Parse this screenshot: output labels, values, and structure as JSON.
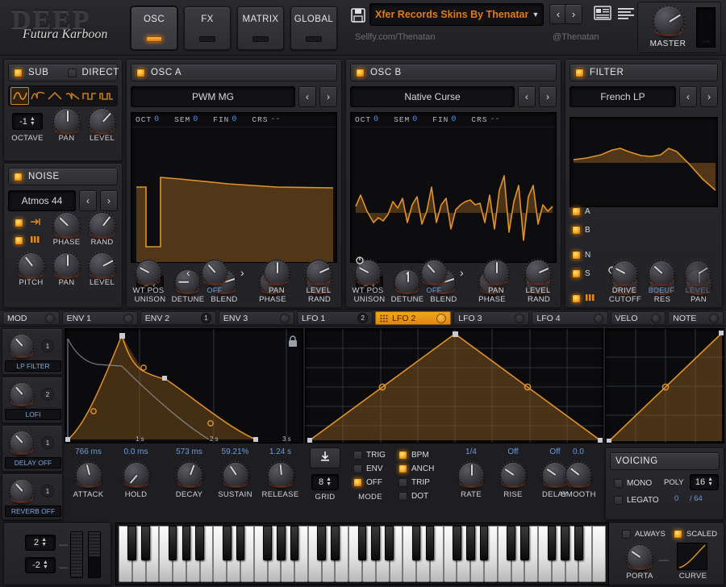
{
  "brand": {
    "name": "DEEP",
    "script": "Futura Karboon"
  },
  "top": {
    "tabs": [
      {
        "label": "OSC",
        "active": true
      },
      {
        "label": "FX",
        "active": false
      },
      {
        "label": "MATRIX",
        "active": false
      },
      {
        "label": "GLOBAL",
        "active": false
      }
    ],
    "save_icon": "floppy-disk-icon",
    "preset_name": "Xfer Records Skins By Thenatan",
    "prev_label": "‹",
    "next_label": "›",
    "menu_icon_1": "preset-browser-icon",
    "menu_icon_2": "menu-list-icon",
    "left_link": "Sellfy.com/Thenatan",
    "right_link": "@Thenatan",
    "master_label": "MASTER",
    "meter_marks": "- -"
  },
  "sub": {
    "title": "SUB",
    "direct_label": "DIRECT",
    "direct_on": false,
    "enabled": true,
    "waveforms": [
      "sine-wave-icon",
      "saw-wave-icon",
      "triangle-wave-icon",
      "ramp-wave-icon",
      "square-wave-icon",
      "pulse-wave-icon"
    ],
    "selected_waveform": 0,
    "octave_value": "-1",
    "knobs": [
      {
        "label": "OCTAVE"
      },
      {
        "label": "PAN",
        "angle": 0
      },
      {
        "label": "LEVEL",
        "angle": 42
      }
    ]
  },
  "noise": {
    "title": "NOISE",
    "enabled": true,
    "preset": "Atmos 44",
    "toggle_a": "loop-icon",
    "toggle_b": "keytrack-icon",
    "knobs": [
      {
        "label": "PHASE",
        "angle": -46
      },
      {
        "label": "RAND",
        "angle": 38
      },
      {
        "label": "PITCH",
        "angle": -38
      },
      {
        "label": "PAN",
        "angle": 0
      },
      {
        "label": "LEVEL",
        "angle": 62
      }
    ]
  },
  "oscA": {
    "title": "OSC A",
    "enabled": true,
    "wavetable": "PWM MG",
    "info": [
      {
        "label": "OCT",
        "value": "0"
      },
      {
        "label": "SEM",
        "value": "0"
      },
      {
        "label": "FIN",
        "value": "0"
      },
      {
        "label": "CRS",
        "value": "--"
      }
    ],
    "unison_value": "1",
    "unison_label": "UNISON",
    "wt_mode": "OFF",
    "knobs": [
      {
        "label": "DETUNE",
        "angle": -90
      },
      {
        "label": "BLEND",
        "angle": 72
      },
      {
        "label": "PHASE",
        "angle": 0
      },
      {
        "label": "RAND",
        "angle": 52
      },
      {
        "label": "WT POS",
        "angle": -62
      },
      {
        "label": "OFF",
        "angle": -42
      },
      {
        "label": "PAN",
        "angle": 0
      },
      {
        "label": "LEVEL",
        "angle": 66
      }
    ]
  },
  "oscB": {
    "title": "OSC B",
    "enabled": true,
    "wavetable": "Native Curse",
    "info": [
      {
        "label": "OCT",
        "value": "0"
      },
      {
        "label": "SEM",
        "value": "0"
      },
      {
        "label": "FIN",
        "value": "0"
      },
      {
        "label": "CRS",
        "value": "--"
      }
    ],
    "unison_value": "1",
    "unison_label": "UNISON",
    "wt_mode": "OFF",
    "knobs": [
      {
        "label": "DETUNE",
        "angle": 0
      },
      {
        "label": "BLEND",
        "angle": 72
      },
      {
        "label": "PHASE",
        "angle": 0
      },
      {
        "label": "RAND",
        "angle": 52
      },
      {
        "label": "WT POS",
        "angle": -62
      },
      {
        "label": "OFF",
        "angle": -42
      },
      {
        "label": "PAN",
        "angle": 0
      },
      {
        "label": "LEVEL",
        "angle": 66
      }
    ]
  },
  "filter": {
    "title": "FILTER",
    "enabled": true,
    "type": "French LP",
    "routing": [
      {
        "label": "A",
        "on": true
      },
      {
        "label": "B",
        "on": true
      },
      {
        "label": "N",
        "on": true
      },
      {
        "label": "S",
        "on": true
      },
      {
        "label": "keys-icon",
        "on": true,
        "icon": true
      }
    ],
    "knobs": [
      {
        "label": "CUTOFF",
        "angle": 42
      },
      {
        "label": "RES",
        "angle": -52
      },
      {
        "label": "PAN",
        "angle": 0
      },
      {
        "label": "DRIVE",
        "angle": -62
      },
      {
        "label": "BOEUF",
        "angle": -48
      },
      {
        "label": "LEVEL",
        "angle": 58
      }
    ],
    "boeuf_highlight": "#6c9bd8",
    "level_dim": true
  },
  "modtabs": [
    {
      "label": "MOD",
      "type": "ring",
      "active": false
    },
    {
      "label": "ENV 1",
      "type": "ring",
      "active": false
    },
    {
      "label": "ENV 2",
      "type": "num",
      "num": "1",
      "active": false
    },
    {
      "label": "ENV 3",
      "type": "ring",
      "active": false
    },
    {
      "label": "LFO 1",
      "type": "num",
      "num": "2",
      "active": false
    },
    {
      "label": "LFO 2",
      "type": "ring",
      "active": true,
      "grid": true
    },
    {
      "label": "LFO 3",
      "type": "ring",
      "active": false
    },
    {
      "label": "LFO 4",
      "type": "ring",
      "active": false
    },
    {
      "label": "VELO",
      "type": "ring",
      "active": false
    },
    {
      "label": "NOTE",
      "type": "ring",
      "active": false
    }
  ],
  "fxrack": [
    {
      "label": "LP FILTER",
      "num": "1",
      "angle": -42
    },
    {
      "label": "LOFI",
      "num": "2",
      "angle": -42
    },
    {
      "label": "DELAY OFF",
      "num": "1",
      "angle": -42
    },
    {
      "label": "REVERB OFF",
      "num": "1",
      "angle": -42
    }
  ],
  "env": {
    "time_labels": [
      "1 s",
      "2 s",
      "3 s"
    ],
    "lock_icon": "lock-icon",
    "params": [
      {
        "label": "ATTACK",
        "value": "766 ms",
        "angle": -14
      },
      {
        "label": "HOLD",
        "value": "0.0 ms",
        "angle": -140
      },
      {
        "label": "DECAY",
        "value": "573 ms",
        "angle": 20
      },
      {
        "label": "SUSTAIN",
        "value": "59.21%",
        "angle": -34
      },
      {
        "label": "RELEASE",
        "value": "1.24 s",
        "angle": -6
      }
    ]
  },
  "lfo": {
    "download_icon": "download-icon",
    "grid_value": "8",
    "grid_label": "GRID",
    "mode_label": "MODE",
    "modes": [
      {
        "label": "TRIG",
        "on": false
      },
      {
        "label": "ENV",
        "on": false
      },
      {
        "label": "OFF",
        "on": true
      }
    ],
    "syncs": [
      {
        "label": "BPM",
        "on": true
      },
      {
        "label": "ANCH",
        "on": true
      },
      {
        "label": "TRIP",
        "on": false
      },
      {
        "label": "DOT",
        "on": false
      }
    ],
    "params": [
      {
        "label": "RATE",
        "value": "1/4",
        "angle": 0
      },
      {
        "label": "RISE",
        "value": "Off",
        "angle": -56
      },
      {
        "label": "DELAY",
        "value": "Off",
        "angle": -56
      },
      {
        "label": "SMOOTH",
        "value": "0.0",
        "angle": -52
      }
    ]
  },
  "voicing": {
    "title": "VOICING",
    "mono_label": "MONO",
    "mono_on": false,
    "legato_label": "LEGATO",
    "legato_on": false,
    "poly_label": "POLY",
    "poly_value": "16",
    "voices_used": "0",
    "voices_total": "/ 64",
    "always_label": "ALWAYS",
    "always_on": false,
    "scaled_label": "SCALED",
    "scaled_on": true,
    "porta_label": "PORTA",
    "porta_angle": -56,
    "curve_label": "CURVE",
    "dash": "—"
  },
  "wheels": {
    "top_value": "2",
    "bottom_value": "-2",
    "dash": "—"
  },
  "chart_data": [
    {
      "type": "line",
      "title": "OSC A wavetable",
      "x": [
        0,
        0.06,
        0.08,
        0.085,
        0.16,
        0.165,
        0.17,
        0.22,
        0.45,
        0.7,
        1.0
      ],
      "y": [
        0.5,
        0.5,
        0.05,
        0.04,
        0.04,
        0.62,
        0.62,
        0.6,
        0.56,
        0.53,
        0.52
      ],
      "ylim": [
        0,
        1
      ],
      "xlabel": "",
      "ylabel": ""
    },
    {
      "type": "line",
      "title": "OSC B wavetable",
      "x": [
        0,
        0.03,
        0.07,
        0.11,
        0.15,
        0.2,
        0.24,
        0.28,
        0.33,
        0.37,
        0.42,
        0.47,
        0.52,
        0.57,
        0.62,
        0.67,
        0.72,
        0.77,
        0.82,
        0.87,
        0.92,
        0.97,
        1.0
      ],
      "y": [
        0.62,
        0.7,
        0.5,
        0.35,
        0.45,
        0.68,
        0.4,
        0.72,
        0.3,
        0.76,
        0.28,
        0.6,
        0.52,
        0.62,
        0.55,
        0.35,
        0.8,
        0.2,
        0.85,
        0.15,
        0.78,
        0.45,
        0.55
      ],
      "ylim": [
        0,
        1
      ]
    },
    {
      "type": "line",
      "title": "Filter response",
      "x": [
        0,
        0.15,
        0.3,
        0.42,
        0.5,
        0.6,
        0.68,
        0.78,
        0.86,
        1.0
      ],
      "y": [
        0.44,
        0.47,
        0.58,
        0.52,
        0.48,
        0.47,
        0.6,
        0.46,
        0.25,
        0.05
      ],
      "ylim": [
        0,
        1
      ]
    },
    {
      "type": "line",
      "title": "ENV 2 envelope",
      "x": [
        0,
        0.175,
        0.175,
        0.26,
        0.36,
        0.5,
        0.68,
        0.84,
        1.0
      ],
      "y": [
        0,
        1.0,
        1.0,
        0.76,
        0.6,
        0.4,
        0.2,
        0.07,
        0.0
      ],
      "ylim": [
        0,
        1
      ],
      "xticks": [
        0.33,
        0.66,
        1.0
      ],
      "xticklabels": [
        "1 s",
        "2 s",
        "3 s"
      ]
    },
    {
      "type": "line",
      "title": "LFO 2 shape",
      "x": [
        0,
        0.5,
        1.0
      ],
      "y": [
        0,
        1.0,
        0.0
      ],
      "ylim": [
        0,
        1
      ],
      "grid": true
    },
    {
      "type": "line",
      "title": "Porta curve",
      "x": [
        0,
        0.5,
        1.0
      ],
      "y": [
        0,
        0.5,
        1.0
      ],
      "ylim": [
        0,
        1
      ],
      "grid": true
    }
  ]
}
